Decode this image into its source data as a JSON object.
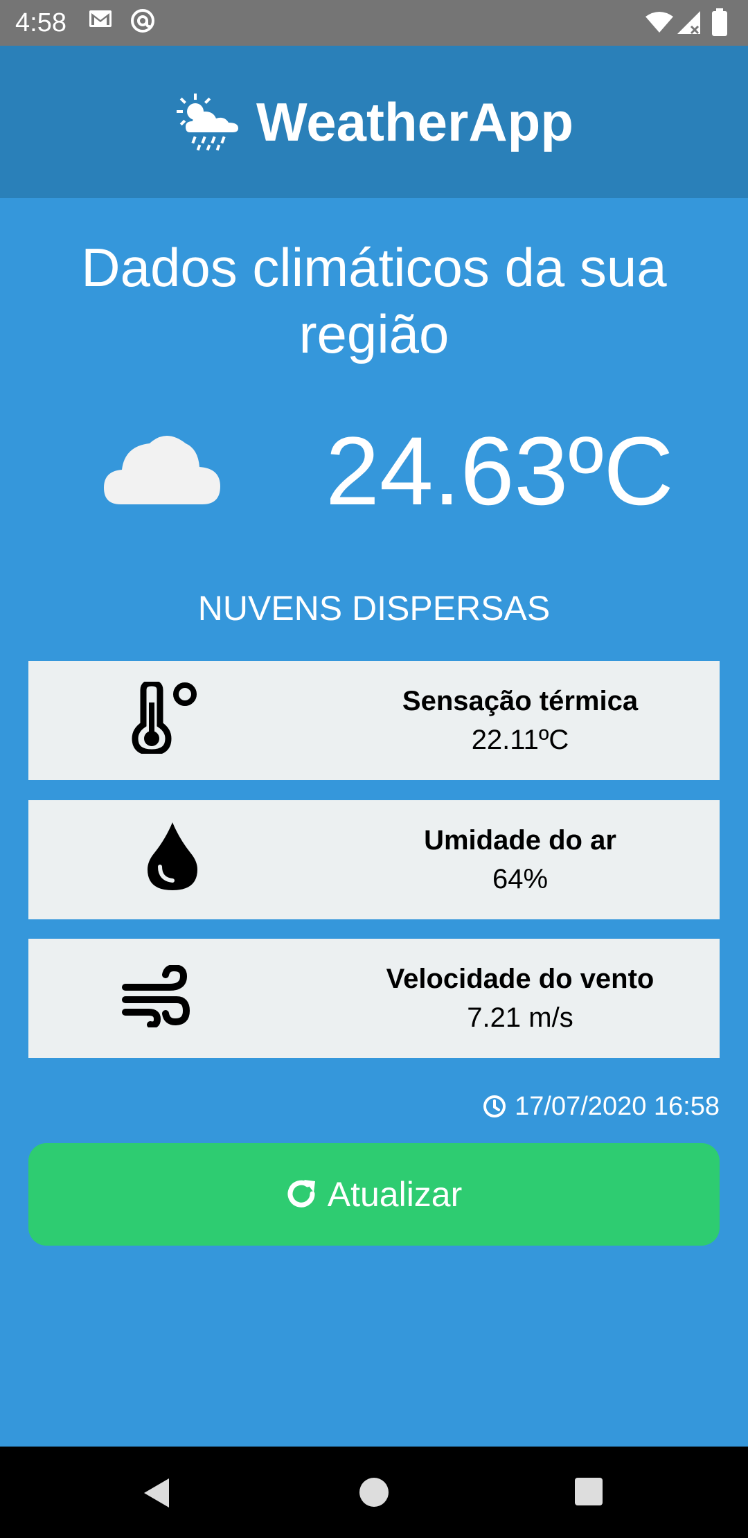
{
  "status_bar": {
    "time": "4:58",
    "left_icons": [
      "gmail-icon",
      "at-sign-icon"
    ],
    "right_icons": [
      "wifi-icon",
      "signal-icon",
      "battery-icon"
    ]
  },
  "header": {
    "title": "WeatherApp",
    "logo_icon": "cloud-sun-rain-icon"
  },
  "main": {
    "heading": "Dados climáticos da sua região",
    "weather_icon": "cloud-icon",
    "temperature": "24.63ºC",
    "description": "NUVENS DISPERSAS",
    "cards": [
      {
        "icon": "thermometer-icon",
        "label": "Sensação térmica",
        "value": "22.11ºC"
      },
      {
        "icon": "water-drop-icon",
        "label": "Umidade do ar",
        "value": "64%"
      },
      {
        "icon": "wind-icon",
        "label": "Velocidade do vento",
        "value": "7.21 m/s"
      }
    ],
    "timestamp": "17/07/2020 16:58",
    "refresh_label": "Atualizar"
  },
  "nav_bar": {
    "buttons": [
      "back-icon",
      "home-icon",
      "recents-icon"
    ]
  },
  "colors": {
    "background": "#3597DB",
    "header": "#2A80B9",
    "status_bar": "#757575",
    "card": "#ECF0F1",
    "button": "#2ECC71"
  }
}
